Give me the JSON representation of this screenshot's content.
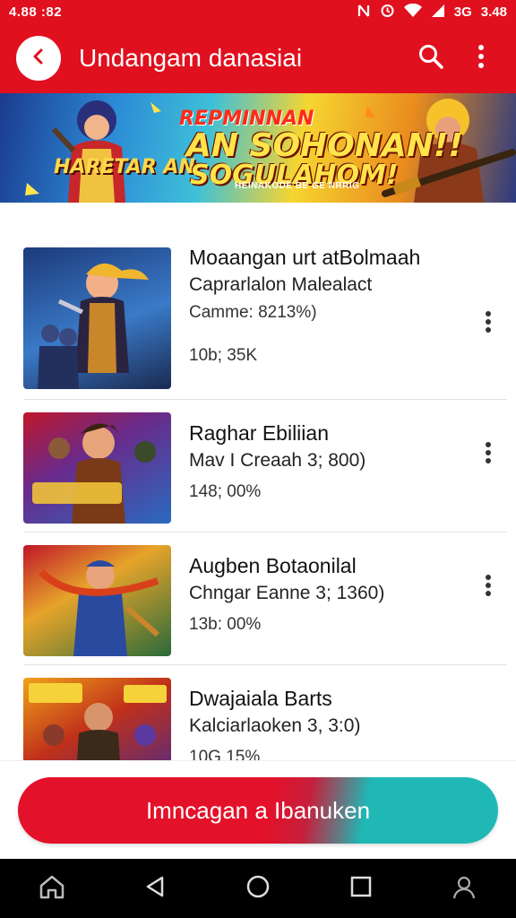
{
  "status_bar": {
    "time": "4.88 :82",
    "indicators": "",
    "network": "3G",
    "battery": "3.48",
    "icons": [
      "nfc-icon",
      "alarm-icon",
      "wifi-icon",
      "signal-icon"
    ]
  },
  "app_bar": {
    "title": "Undangam danasiai",
    "back_icon": "chevron-left-icon",
    "actions": [
      "search-icon",
      "more-vertical-icon"
    ]
  },
  "banner": {
    "line1": "REPMINNAN",
    "line2": "AN SOHONAN!!",
    "line3": "SOGULAHOM!",
    "subline": "HEINAKODE BE GE NRRIG",
    "side_text": "HARETAR AN"
  },
  "list": {
    "items": [
      {
        "title": "Moaangan urt atBolmaah",
        "subtitle": "Caprarlalon Malealact",
        "meta1": "Camme: 8213%)",
        "meta2": "10b; 35K"
      },
      {
        "title": "Raghar Ebiliian",
        "subtitle": "Mav I Creaah 3; 800)",
        "meta1": "",
        "meta2": "148; 00%"
      },
      {
        "title": "Augben Botaonilal",
        "subtitle": "Chngar Eanne 3; 1360)",
        "meta1": "",
        "meta2": "13b: 00%"
      },
      {
        "title": "Dwajaiala Barts",
        "subtitle": "Kalciarlaoken 3, 3:0)",
        "meta1": "",
        "meta2": "10G 15%"
      }
    ]
  },
  "cta": {
    "label": "Imncagan a Ibanuken"
  },
  "nav_bar": {
    "buttons": [
      "home-icon",
      "back-icon",
      "home-circle-icon",
      "recents-icon",
      "profile-icon"
    ]
  },
  "colors": {
    "primary": "#e0101e",
    "accent": "#1fb8b5",
    "nav": "#000000"
  }
}
